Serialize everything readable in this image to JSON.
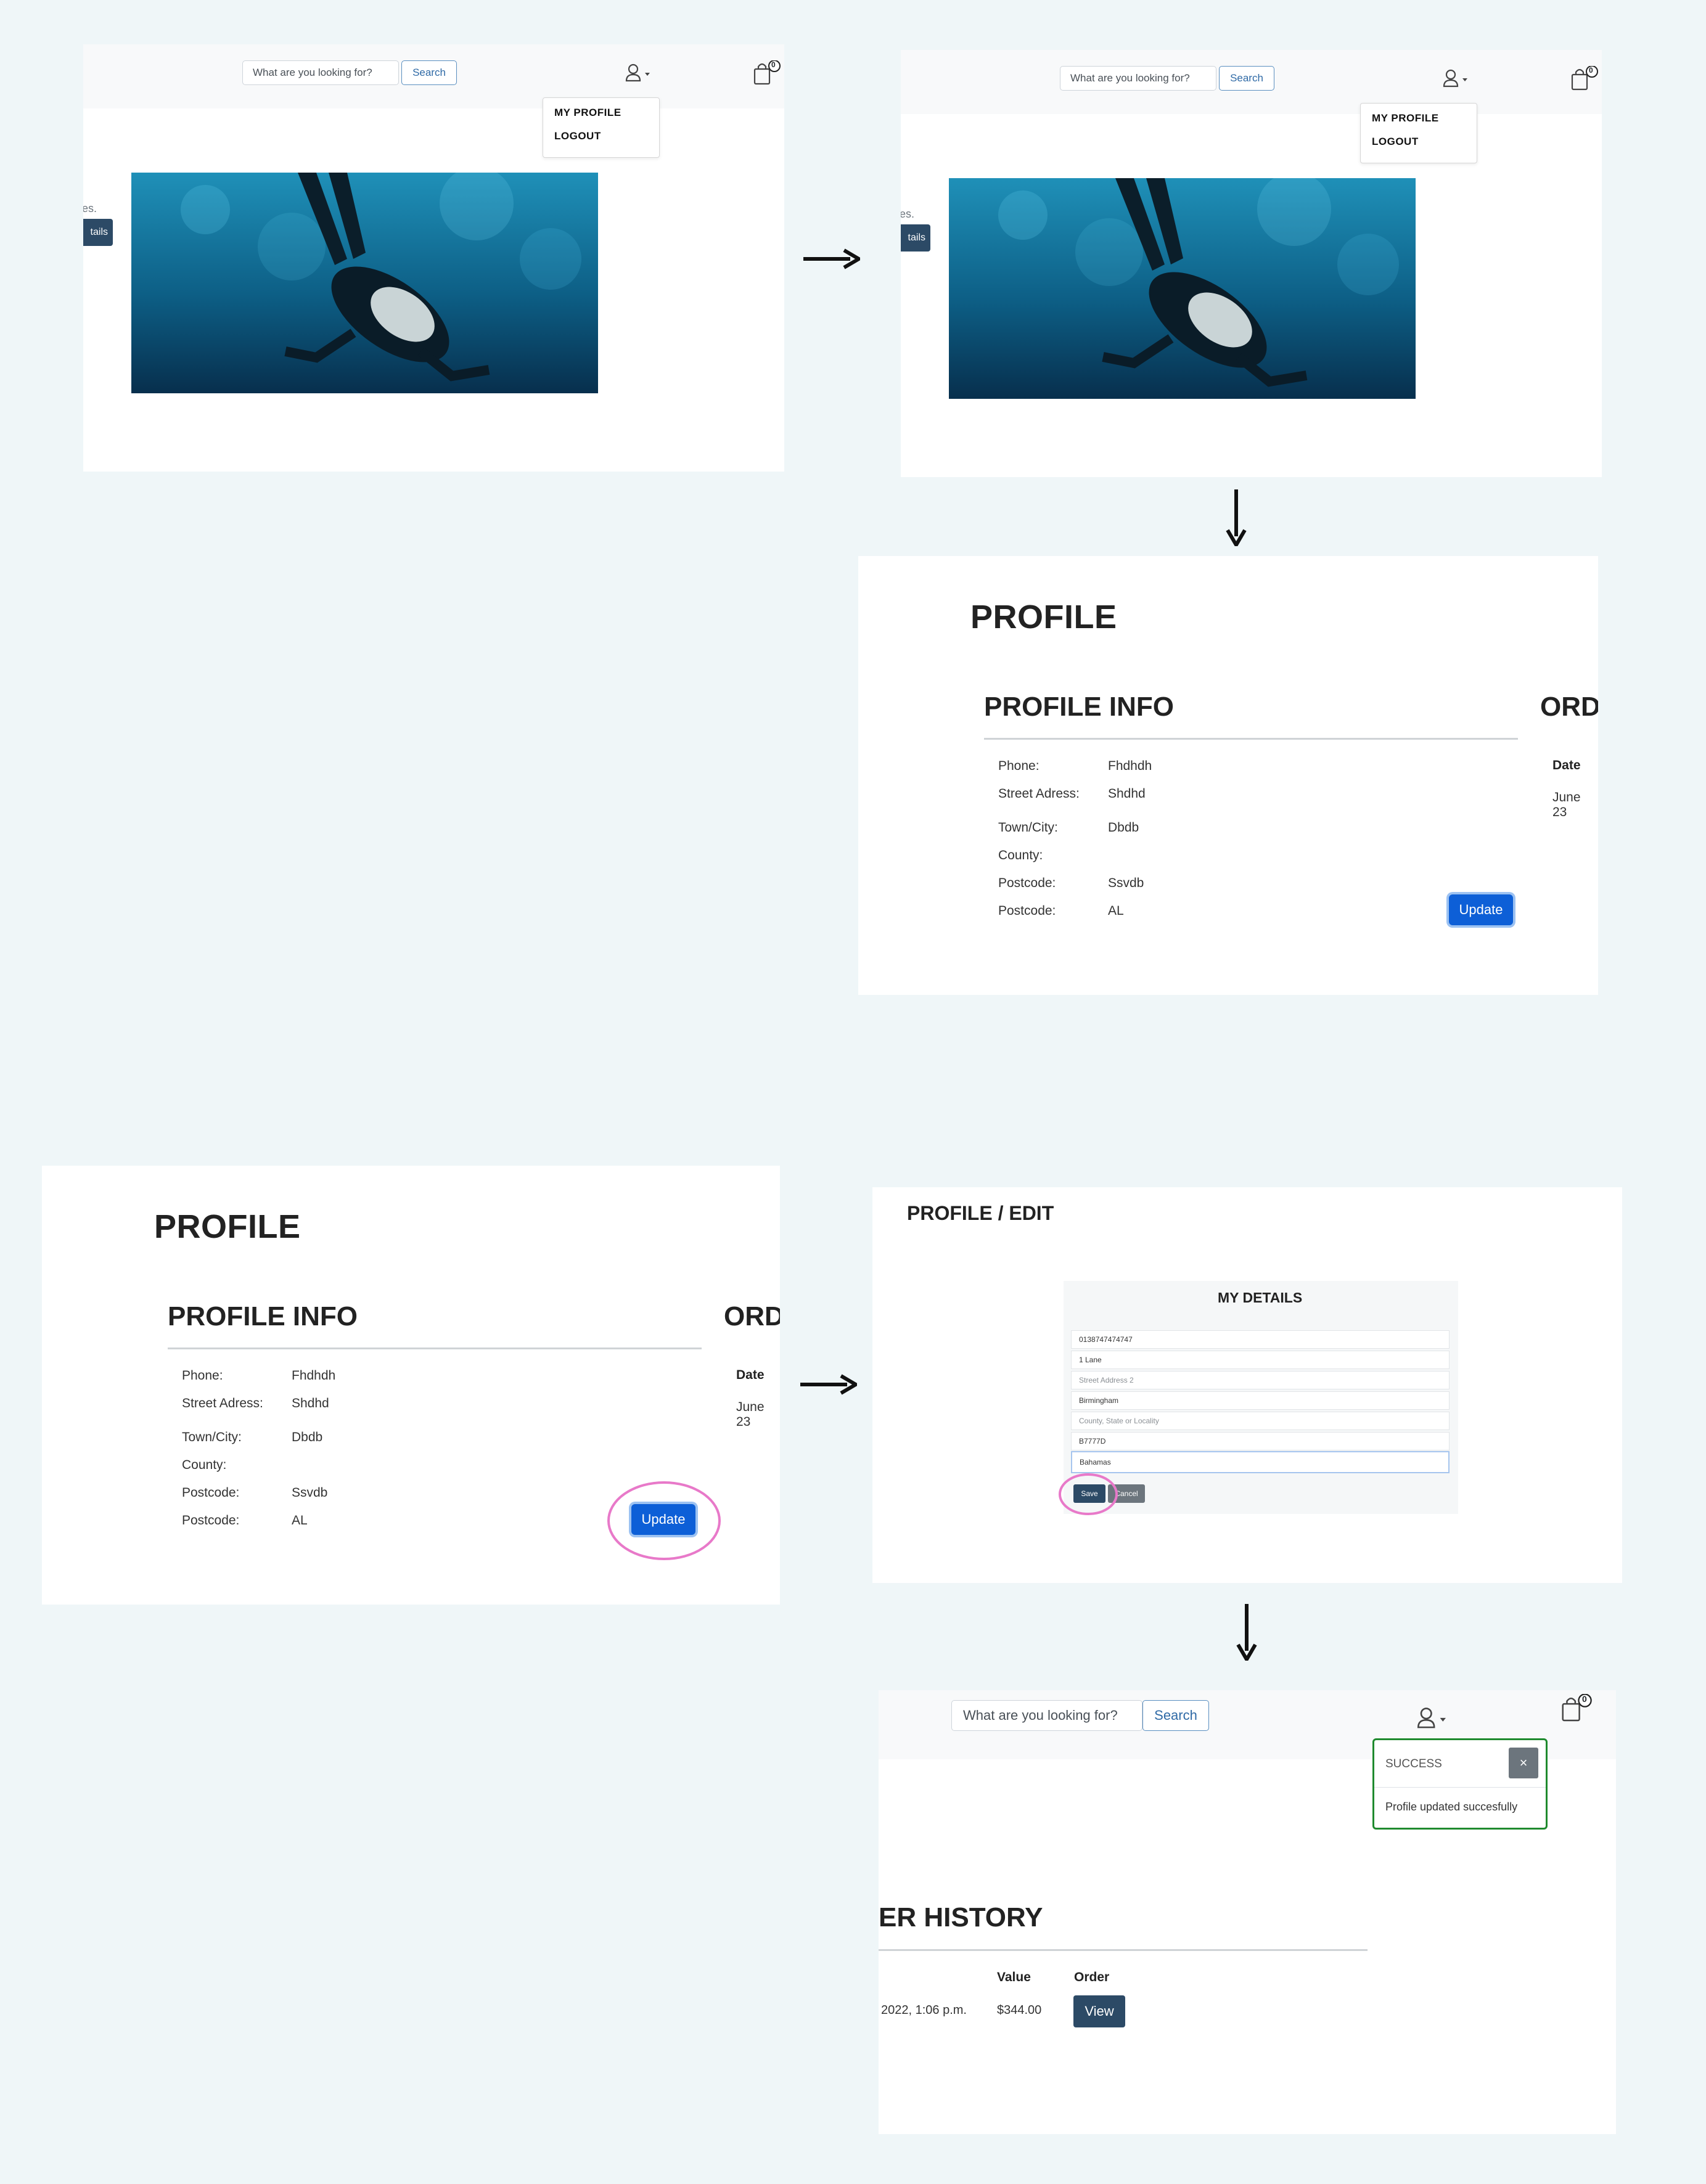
{
  "header": {
    "search_placeholder": "What are you looking for?",
    "search_button": "Search",
    "cart_count": "0",
    "menu": {
      "my_profile": "MY PROFILE",
      "logout": "LOGOUT"
    }
  },
  "hero": {
    "left_text_fragment": "es.",
    "left_text_fragment_2": "s.",
    "details_button_fragment": "tails"
  },
  "profile": {
    "title": "PROFILE",
    "info_title": "PROFILE INFO",
    "orders_title_fragment": "ORD",
    "date_header": "Date",
    "date_value_fragment": "June 23",
    "fields": [
      {
        "label": "Phone:",
        "value": "Fhdhdh"
      },
      {
        "label": "Street Adress:",
        "value": "Shdhd"
      },
      {
        "label": "Town/City:",
        "value": "Dbdb"
      },
      {
        "label": "County:",
        "value": ""
      },
      {
        "label": "Postcode:",
        "value": "Ssvdb"
      },
      {
        "label": "Postcode:",
        "value": "AL"
      }
    ],
    "update_button": "Update"
  },
  "edit": {
    "title": "PROFILE / EDIT",
    "form_title": "MY DETAILS",
    "inputs": [
      {
        "value": "0138747474747",
        "placeholder": ""
      },
      {
        "value": "1 Lane",
        "placeholder": ""
      },
      {
        "value": "",
        "placeholder": "Street Address 2"
      },
      {
        "value": "Birmingham",
        "placeholder": ""
      },
      {
        "value": "",
        "placeholder": "County, State or Locality"
      },
      {
        "value": "B7777D",
        "placeholder": ""
      },
      {
        "value": "Bahamas",
        "placeholder": ""
      }
    ],
    "save_button": "Save",
    "cancel_button": "Cancel"
  },
  "result": {
    "toast_title": "SUCCESS",
    "toast_close": "×",
    "toast_message": "Profile updated succesfully",
    "history_title_fragment": "ER HISTORY",
    "value_header": "Value",
    "order_header": "Order",
    "date_fragment": "2022, 1:06 p.m.",
    "value": "$344.00",
    "view_button": "View"
  },
  "colors": {
    "background": "#eff6f8",
    "primary": "#0d5fd7",
    "dark_button": "#2c4a66",
    "success_border": "#1f8a2e",
    "highlight_circle": "#e879c9"
  }
}
